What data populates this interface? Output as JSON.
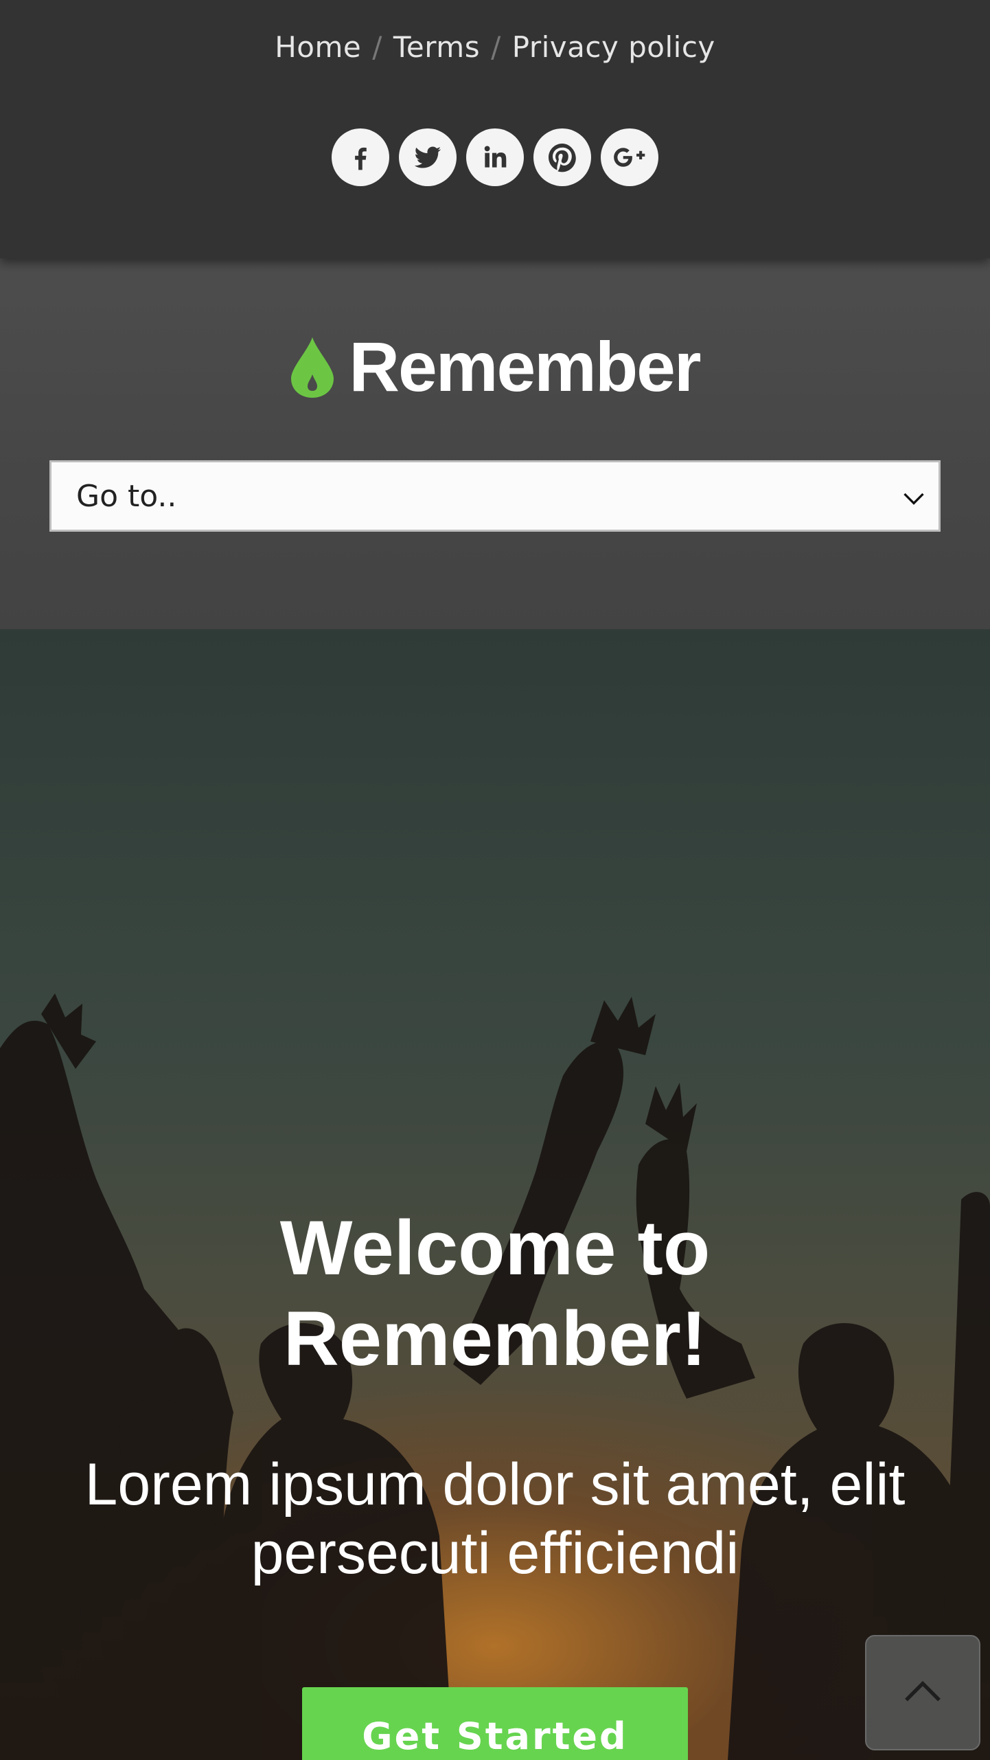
{
  "breadcrumb": {
    "items": [
      "Home",
      "Terms",
      "Privacy policy"
    ],
    "separator": "/"
  },
  "social": {
    "icons": [
      "facebook-icon",
      "twitter-icon",
      "linkedin-icon",
      "pinterest-icon",
      "google-plus-icon"
    ],
    "glyphs": [
      "f",
      "t",
      "in",
      "p",
      "g+"
    ]
  },
  "header": {
    "logo_text": "Remember",
    "logo_icon": "drop-icon",
    "brand_color": "#6cc644",
    "nav_select": {
      "value": "Go to..",
      "icon": "chevron-down-icon"
    }
  },
  "hero": {
    "title_line1": "Welcome to",
    "title_line2": "Remember!",
    "subtitle_line1": "Lorem ipsum dolor sit amet, elit",
    "subtitle_line2": "persecuti efficiendi",
    "cta_label": "Get Started",
    "cta_color": "#66d44f"
  },
  "back_to_top": {
    "icon": "chevron-up-icon"
  }
}
